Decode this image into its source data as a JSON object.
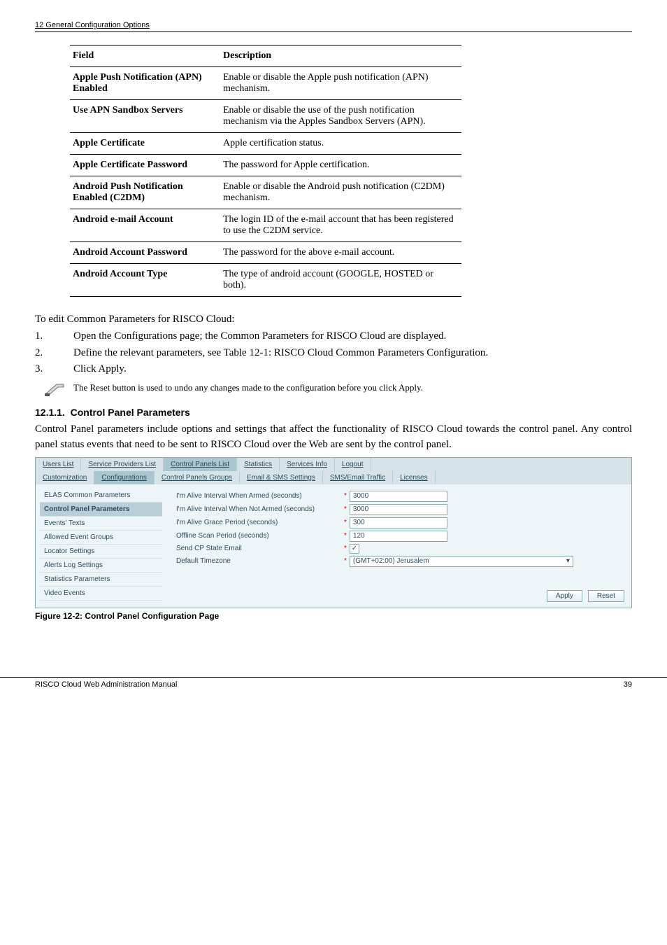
{
  "header": "12 General Configuration Options",
  "table": {
    "col_field": "Field",
    "col_desc": "Description",
    "rows": [
      {
        "field": "Apple Push Notification (APN) Enabled",
        "desc": "Enable or disable the Apple push notification (APN) mechanism."
      },
      {
        "field": "Use APN Sandbox Servers",
        "desc": "Enable or disable the use of the push notification mechanism via the Apples Sandbox Servers (APN)."
      },
      {
        "field": "Apple Certificate",
        "desc": "Apple certification status."
      },
      {
        "field": "Apple Certificate Password",
        "desc": "The password for Apple certification."
      },
      {
        "field": "Android Push Notification Enabled (C2DM)",
        "desc": "Enable or disable the Android push notification (C2DM) mechanism."
      },
      {
        "field": "Android e-mail Account",
        "desc": "The login ID of the e-mail account that has been registered to use the C2DM service."
      },
      {
        "field": "Android Account Password",
        "desc": "The password for the above e-mail account."
      },
      {
        "field": "Android Account Type",
        "desc": "The type of android account (GOOGLE, HOSTED or both)."
      }
    ]
  },
  "intro": "To edit Common Parameters for RISCO Cloud:",
  "steps": [
    {
      "n": "1.",
      "t": "Open the Configurations page; the Common Parameters for RISCO Cloud are displayed."
    },
    {
      "n": "2.",
      "t": "Define the relevant parameters, see Table 12-1: RISCO Cloud Common Parameters Configuration."
    },
    {
      "n": "3.",
      "t": "Click Apply."
    }
  ],
  "note": "The Reset button is used to undo any changes made to the configuration before you click Apply.",
  "section_num": "12.1.1.",
  "section_title": "Control Panel Parameters",
  "section_body": "Control Panel parameters include options and settings that affect the functionality of RISCO Cloud towards the control panel. Any control panel status events that need to be sent to RISCO Cloud over the Web are sent by the control panel.",
  "shot": {
    "tabs1": [
      "Users List",
      "Service Providers List",
      "Control Panels List",
      "Statistics",
      "Services Info",
      "Logout"
    ],
    "tabs2": [
      "Customization",
      "Configurations",
      "Control Panels Groups",
      "Email & SMS Settings",
      "SMS/Email Traffic",
      "Licenses"
    ],
    "tabs1_active": 2,
    "tabs2_active": 1,
    "sidenav": [
      "ELAS Common Parameters",
      "Control Panel Parameters",
      "Events' Texts",
      "Allowed Event Groups",
      "Locator Settings",
      "Alerts Log Settings",
      "Statistics Parameters",
      "Video Events"
    ],
    "sidenav_active": 1,
    "rows": [
      {
        "label": "I'm Alive Interval When Armed (seconds)",
        "type": "input",
        "value": "3000"
      },
      {
        "label": "I'm Alive Interval When Not Armed (seconds)",
        "type": "input",
        "value": "3000"
      },
      {
        "label": "I'm Alive Grace Period (seconds)",
        "type": "input",
        "value": "300"
      },
      {
        "label": "Offline Scan Period (seconds)",
        "type": "input",
        "value": "120"
      },
      {
        "label": "Send CP State Email",
        "type": "check",
        "value": "✓"
      },
      {
        "label": "Default Timezone",
        "type": "select",
        "value": "(GMT+02:00) Jerusalem"
      }
    ],
    "btn_apply": "Apply",
    "btn_reset": "Reset"
  },
  "figcaption": "Figure 12-2: Control Panel Configuration Page",
  "footer_left": "RISCO Cloud Web Administration Manual",
  "footer_right": "39"
}
